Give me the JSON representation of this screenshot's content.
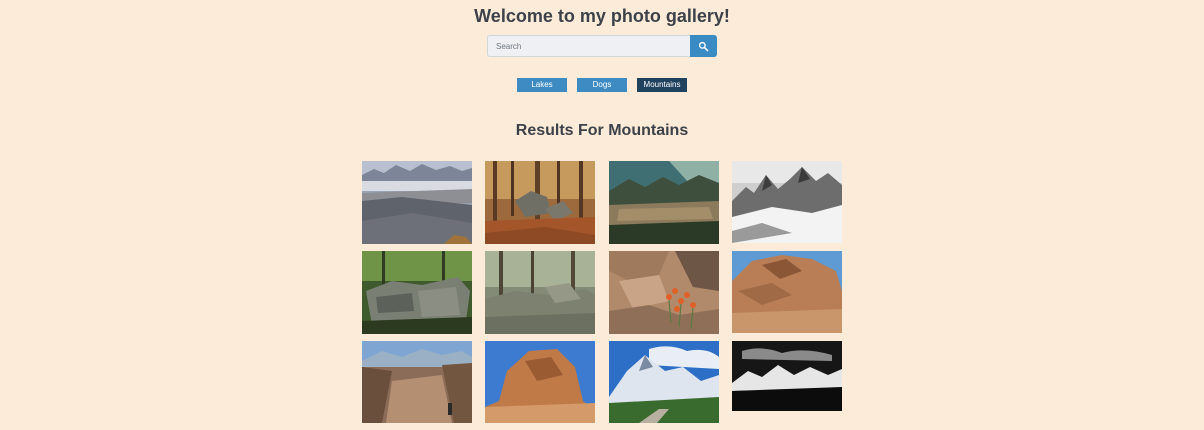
{
  "header": {
    "title": "Welcome to my photo gallery!"
  },
  "search": {
    "placeholder": "Search",
    "value": "",
    "button_icon": "search-icon"
  },
  "filters": [
    {
      "label": "Lakes",
      "active": false
    },
    {
      "label": "Dogs",
      "active": false
    },
    {
      "label": "Mountains",
      "active": true
    }
  ],
  "results": {
    "heading": "Results For Mountains",
    "photos": [
      {
        "name": "misty-valley-photo"
      },
      {
        "name": "autumn-forest-rocks-photo"
      },
      {
        "name": "mountain-city-valley-photo"
      },
      {
        "name": "black-white-alpine-peaks-photo"
      },
      {
        "name": "mossy-rock-formation-photo"
      },
      {
        "name": "forest-boulders-photo"
      },
      {
        "name": "rocks-orange-wildflowers-photo"
      },
      {
        "name": "red-rock-formation-photo"
      },
      {
        "name": "canyon-hiker-photo"
      },
      {
        "name": "sandstone-boulder-blue-sky-photo"
      },
      {
        "name": "snowy-peak-meadow-photo"
      },
      {
        "name": "black-white-snowy-range-photo"
      }
    ]
  },
  "colors": {
    "background": "#fbebd8",
    "accent": "#3a8ac4",
    "active_filter": "#21425f",
    "text": "#3d4149"
  }
}
